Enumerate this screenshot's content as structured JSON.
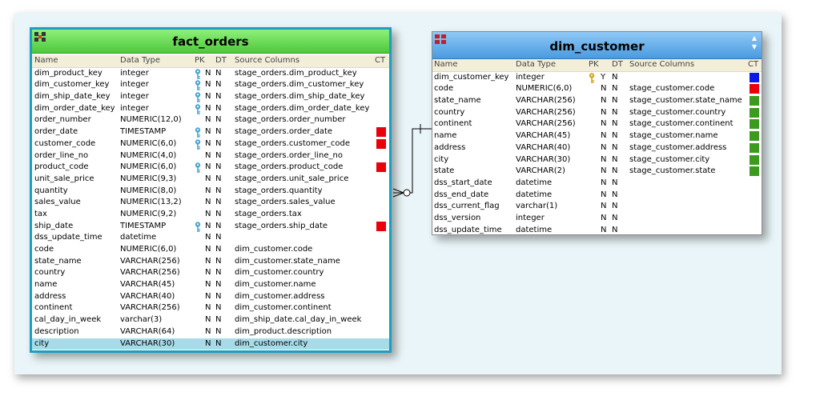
{
  "fact_orders": {
    "title": "fact_orders",
    "headers": {
      "name": "Name",
      "type": "Data Type",
      "pk": "PK",
      "dt": "DT",
      "src": "Source Columns",
      "ct": "CT"
    },
    "rows": [
      {
        "name": "dim_product_key",
        "type": "integer",
        "key": true,
        "pk": "N",
        "dt": "N",
        "src": "stage_orders.dim_product_key",
        "ct": ""
      },
      {
        "name": "dim_customer_key",
        "type": "integer",
        "key": true,
        "pk": "N",
        "dt": "N",
        "src": "stage_orders.dim_customer_key",
        "ct": ""
      },
      {
        "name": "dim_ship_date_key",
        "type": "integer",
        "key": true,
        "pk": "N",
        "dt": "N",
        "src": "stage_orders.dim_ship_date_key",
        "ct": ""
      },
      {
        "name": "dim_order_date_key",
        "type": "integer",
        "key": true,
        "pk": "N",
        "dt": "N",
        "src": "stage_orders.dim_order_date_key",
        "ct": ""
      },
      {
        "name": "order_number",
        "type": "NUMERIC(12,0)",
        "key": false,
        "pk": "N",
        "dt": "N",
        "src": "stage_orders.order_number",
        "ct": ""
      },
      {
        "name": "order_date",
        "type": "TIMESTAMP",
        "key": true,
        "pk": "N",
        "dt": "N",
        "src": "stage_orders.order_date",
        "ct": "#e8000b"
      },
      {
        "name": "customer_code",
        "type": "NUMERIC(6,0)",
        "key": true,
        "pk": "N",
        "dt": "N",
        "src": "stage_orders.customer_code",
        "ct": "#e8000b"
      },
      {
        "name": "order_line_no",
        "type": "NUMERIC(4,0)",
        "key": false,
        "pk": "N",
        "dt": "N",
        "src": "stage_orders.order_line_no",
        "ct": ""
      },
      {
        "name": "product_code",
        "type": "NUMERIC(6,0)",
        "key": true,
        "pk": "N",
        "dt": "N",
        "src": "stage_orders.product_code",
        "ct": "#e8000b"
      },
      {
        "name": "unit_sale_price",
        "type": "NUMERIC(9,3)",
        "key": false,
        "pk": "N",
        "dt": "N",
        "src": "stage_orders.unit_sale_price",
        "ct": ""
      },
      {
        "name": "quantity",
        "type": "NUMERIC(8,0)",
        "key": false,
        "pk": "N",
        "dt": "N",
        "src": "stage_orders.quantity",
        "ct": ""
      },
      {
        "name": "sales_value",
        "type": "NUMERIC(13,2)",
        "key": false,
        "pk": "N",
        "dt": "N",
        "src": "stage_orders.sales_value",
        "ct": ""
      },
      {
        "name": "tax",
        "type": "NUMERIC(9,2)",
        "key": false,
        "pk": "N",
        "dt": "N",
        "src": "stage_orders.tax",
        "ct": ""
      },
      {
        "name": "ship_date",
        "type": "TIMESTAMP",
        "key": true,
        "pk": "N",
        "dt": "N",
        "src": "stage_orders.ship_date",
        "ct": "#e8000b"
      },
      {
        "name": "dss_update_time",
        "type": "datetime",
        "key": false,
        "pk": "N",
        "dt": "N",
        "src": "",
        "ct": ""
      },
      {
        "name": "code",
        "type": "NUMERIC(6,0)",
        "key": false,
        "pk": "N",
        "dt": "N",
        "src": "dim_customer.code",
        "ct": ""
      },
      {
        "name": "state_name",
        "type": "VARCHAR(256)",
        "key": false,
        "pk": "N",
        "dt": "N",
        "src": "dim_customer.state_name",
        "ct": ""
      },
      {
        "name": "country",
        "type": "VARCHAR(256)",
        "key": false,
        "pk": "N",
        "dt": "N",
        "src": "dim_customer.country",
        "ct": ""
      },
      {
        "name": "name",
        "type": "VARCHAR(45)",
        "key": false,
        "pk": "N",
        "dt": "N",
        "src": "dim_customer.name",
        "ct": ""
      },
      {
        "name": "address",
        "type": "VARCHAR(40)",
        "key": false,
        "pk": "N",
        "dt": "N",
        "src": "dim_customer.address",
        "ct": ""
      },
      {
        "name": "continent",
        "type": "VARCHAR(256)",
        "key": false,
        "pk": "N",
        "dt": "N",
        "src": "dim_customer.continent",
        "ct": ""
      },
      {
        "name": "cal_day_in_week",
        "type": "varchar(3)",
        "key": false,
        "pk": "N",
        "dt": "N",
        "src": "dim_ship_date.cal_day_in_week",
        "ct": ""
      },
      {
        "name": "description",
        "type": "VARCHAR(64)",
        "key": false,
        "pk": "N",
        "dt": "N",
        "src": "dim_product.description",
        "ct": ""
      },
      {
        "name": "city",
        "type": "VARCHAR(30)",
        "key": false,
        "pk": "N",
        "dt": "N",
        "src": "dim_customer.city",
        "ct": "",
        "selected": true
      }
    ]
  },
  "dim_customer": {
    "title": "dim_customer",
    "headers": {
      "name": "Name",
      "type": "Data Type",
      "pk": "PK",
      "dt": "DT",
      "src": "Source Columns",
      "ct": "CT"
    },
    "rows": [
      {
        "name": "dim_customer_key",
        "type": "integer",
        "key": true,
        "pk": "Y",
        "dt": "N",
        "src": "",
        "ct": "#0a18e8"
      },
      {
        "name": "code",
        "type": "NUMERIC(6,0)",
        "key": false,
        "pk": "N",
        "dt": "N",
        "src": "stage_customer.code",
        "ct": "#e8000b"
      },
      {
        "name": "state_name",
        "type": "VARCHAR(256)",
        "key": false,
        "pk": "N",
        "dt": "N",
        "src": "stage_customer.state_name",
        "ct": "#3c9a1e"
      },
      {
        "name": "country",
        "type": "VARCHAR(256)",
        "key": false,
        "pk": "N",
        "dt": "N",
        "src": "stage_customer.country",
        "ct": "#3c9a1e"
      },
      {
        "name": "continent",
        "type": "VARCHAR(256)",
        "key": false,
        "pk": "N",
        "dt": "N",
        "src": "stage_customer.continent",
        "ct": "#3c9a1e"
      },
      {
        "name": "name",
        "type": "VARCHAR(45)",
        "key": false,
        "pk": "N",
        "dt": "N",
        "src": "stage_customer.name",
        "ct": "#3c9a1e"
      },
      {
        "name": "address",
        "type": "VARCHAR(40)",
        "key": false,
        "pk": "N",
        "dt": "N",
        "src": "stage_customer.address",
        "ct": "#3c9a1e"
      },
      {
        "name": "city",
        "type": "VARCHAR(30)",
        "key": false,
        "pk": "N",
        "dt": "N",
        "src": "stage_customer.city",
        "ct": "#3c9a1e"
      },
      {
        "name": "state",
        "type": "VARCHAR(2)",
        "key": false,
        "pk": "N",
        "dt": "N",
        "src": "stage_customer.state",
        "ct": "#3c9a1e"
      },
      {
        "name": "dss_start_date",
        "type": "datetime",
        "key": false,
        "pk": "N",
        "dt": "N",
        "src": "",
        "ct": ""
      },
      {
        "name": "dss_end_date",
        "type": "datetime",
        "key": false,
        "pk": "N",
        "dt": "N",
        "src": "",
        "ct": ""
      },
      {
        "name": "dss_current_flag",
        "type": "varchar(1)",
        "key": false,
        "pk": "N",
        "dt": "N",
        "src": "",
        "ct": ""
      },
      {
        "name": "dss_version",
        "type": "integer",
        "key": false,
        "pk": "N",
        "dt": "N",
        "src": "",
        "ct": ""
      },
      {
        "name": "dss_update_time",
        "type": "datetime",
        "key": false,
        "pk": "N",
        "dt": "N",
        "src": "",
        "ct": ""
      }
    ]
  },
  "colors": {
    "fact_key": "#4aa6d0",
    "dim_key": "#d4a417",
    "selected_row": "#a8dbe8"
  }
}
